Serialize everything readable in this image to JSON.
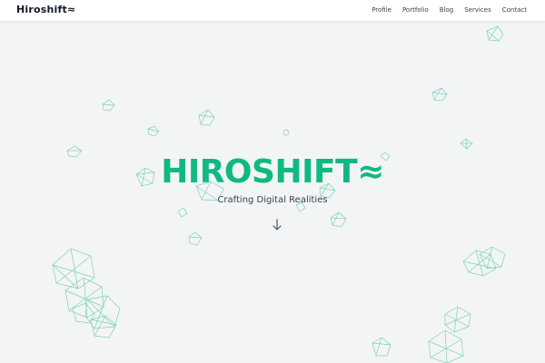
{
  "brand": {
    "name": "Hiroshift≈"
  },
  "nav": {
    "items": [
      {
        "label": "Profile"
      },
      {
        "label": "Portfolio"
      },
      {
        "label": "Blog"
      },
      {
        "label": "Services"
      },
      {
        "label": "Contact"
      }
    ]
  },
  "hero": {
    "title": "HIROSHIFT≈",
    "subtitle": "Crafting Digital Realities",
    "scroll_icon": "arrow-down-icon"
  },
  "colors": {
    "accent": "#10b981",
    "background": "#f3f4f6",
    "wireframe": "#7dd3b4"
  }
}
